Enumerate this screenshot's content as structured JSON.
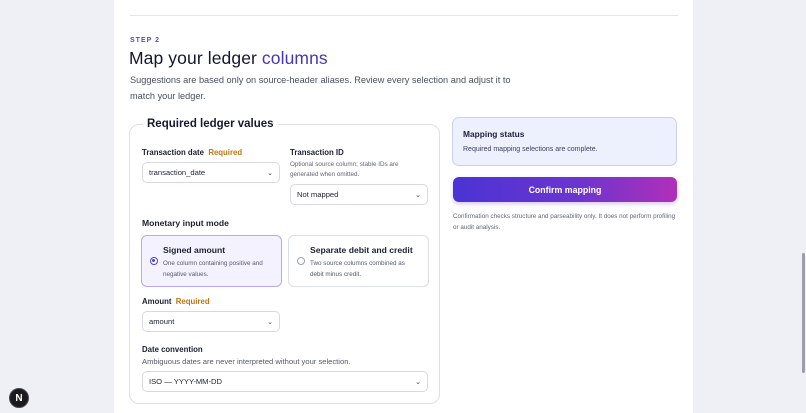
{
  "header": {
    "step_label": "STEP 2",
    "title_main": "Map your ledger ",
    "title_accent": "columns",
    "subtitle": "Suggestions are based only on source-header aliases. Review every selection and adjust it to match your ledger."
  },
  "required_panel": {
    "legend": "Required ledger values",
    "transaction_date": {
      "label": "Transaction date",
      "required_tag": "Required",
      "value": "transaction_date"
    },
    "transaction_id": {
      "label": "Transaction ID",
      "hint": "Optional source column; stable IDs are generated when omitted.",
      "value": "Not mapped"
    },
    "monetary_mode": {
      "title": "Monetary input mode",
      "options": [
        {
          "title": "Signed amount",
          "desc": "One column containing positive and negative values.",
          "selected": true
        },
        {
          "title": "Separate debit and credit",
          "desc": "Two source columns combined as debit minus credit.",
          "selected": false
        }
      ]
    },
    "amount": {
      "label": "Amount",
      "required_tag": "Required",
      "value": "amount"
    },
    "date_convention": {
      "title": "Date convention",
      "help": "Ambiguous dates are never interpreted without your selection.",
      "value": "ISO — YYYY-MM-DD"
    }
  },
  "status": {
    "title": "Mapping status",
    "text": "Required mapping selections are complete."
  },
  "confirm": {
    "label": "Confirm mapping",
    "note": "Confirmation checks structure and parseability only. It does not perform profiling or audit analysis."
  },
  "icons": {
    "select_chevron": "chevron-down-icon",
    "dev_badge": "N"
  },
  "colors": {
    "accent": "#4b33d4",
    "accent_end": "#b12fb9",
    "required": "#c0740f",
    "status_bg": "#edf0fd"
  }
}
